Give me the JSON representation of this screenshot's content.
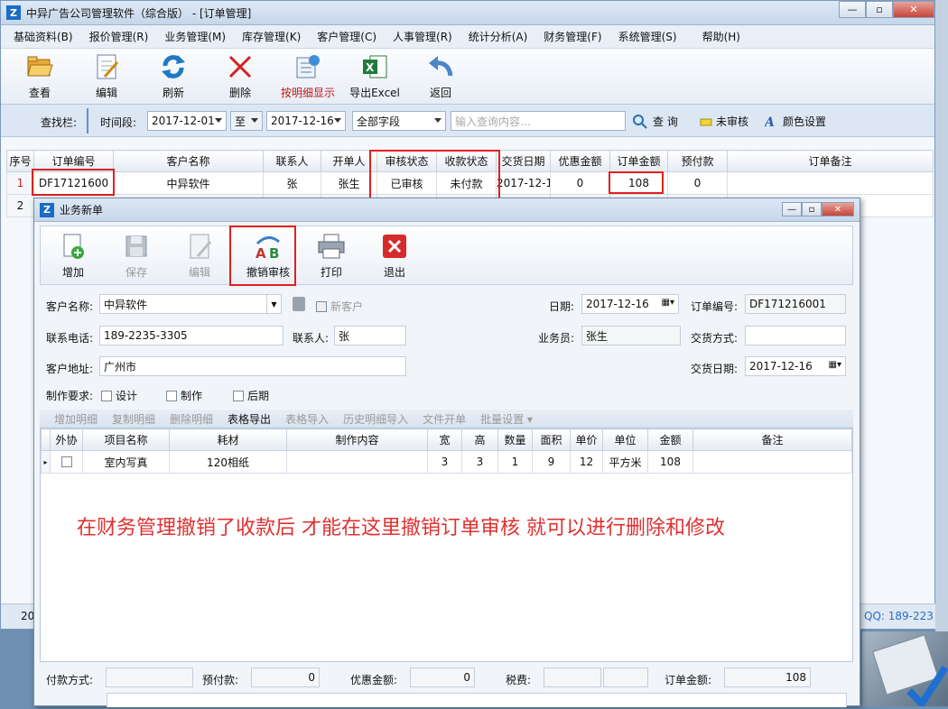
{
  "main": {
    "title": "中异广告公司管理软件（综合版） - [订单管理]",
    "menu": [
      "基础资料(B)",
      "报价管理(R)",
      "业务管理(M)",
      "库存管理(K)",
      "客户管理(C)",
      "人事管理(R)",
      "统计分析(A)",
      "财务管理(F)",
      "系统管理(S)",
      "帮助(H)"
    ],
    "toolbar": {
      "view": "查看",
      "edit": "编辑",
      "refresh": "刷新",
      "delete": "删除",
      "detail": "按明细显示",
      "excel": "导出Excel",
      "back": "返回"
    },
    "search": {
      "label": "查找栏:",
      "period": "时间段:",
      "from": "2017-12-01",
      "to_label": "至",
      "to": "2017-12-16",
      "field": "全部字段",
      "placeholder": "输入查询内容…",
      "query": "查 询",
      "unaudited": "未审核",
      "color": "颜色设置"
    },
    "grid": {
      "headers": [
        "序号",
        "订单编号",
        "客户名称",
        "联系人",
        "开单人",
        "审核状态",
        "收款状态",
        "交货日期",
        "优惠金额",
        "订单金额",
        "预付款",
        "订单备注"
      ],
      "row1": [
        "1",
        "DF17121600",
        "中异软件",
        "张",
        "张生",
        "已审核",
        "未付款",
        "2017-12-1",
        "0",
        "108",
        "0",
        ""
      ],
      "row2_no": "2"
    },
    "status_left": "20",
    "status_qq": "QQ: 189-223"
  },
  "dialog": {
    "title": "业务新单",
    "toolbar": {
      "add": "增加",
      "save": "保存",
      "edit": "编辑",
      "cancel_audit": "撤销审核",
      "print": "打印",
      "exit": "退出"
    },
    "form": {
      "customer_label": "客户名称:",
      "customer": "中异软件",
      "new_customer": "新客户",
      "date_label": "日期:",
      "date": "2017-12-16",
      "order_no_label": "订单编号:",
      "order_no": "DF171216001",
      "phone_label": "联系电话:",
      "phone": "189-2235-3305",
      "contact_label": "联系人:",
      "contact": "张",
      "salesman_label": "业务员:",
      "salesman": "张生",
      "delivery_method_label": "交货方式:",
      "delivery_method": "",
      "address_label": "客户地址:",
      "address": "广州市",
      "delivery_date_label": "交货日期:",
      "delivery_date": "2017-12-16",
      "req_label": "制作要求:",
      "req_design": "设计",
      "req_make": "制作",
      "req_post": "后期"
    },
    "subtool": [
      "增加明细",
      "复制明细",
      "删除明细",
      "表格导出",
      "表格导入",
      "历史明细导入",
      "文件开单",
      "批量设置 ▾"
    ],
    "detail": {
      "headers": [
        "外协",
        "项目名称",
        "耗材",
        "制作内容",
        "宽",
        "高",
        "数量",
        "面积",
        "单价",
        "单位",
        "金额",
        "备注"
      ],
      "row": [
        "",
        "室内写真",
        "120相纸",
        "",
        "3",
        "3",
        "1",
        "9",
        "12",
        "平方米",
        "108",
        ""
      ]
    },
    "annotation": "在财务管理撤销了收款后 才能在这里撤销订单审核 就可以进行删除和修改",
    "footer": {
      "pay_method_label": "付款方式:",
      "prepay_label": "预付款:",
      "prepay": "0",
      "discount_label": "优惠金额:",
      "discount": "0",
      "tax_label": "税费:",
      "total_label": "订单金额:",
      "total": "108"
    }
  }
}
